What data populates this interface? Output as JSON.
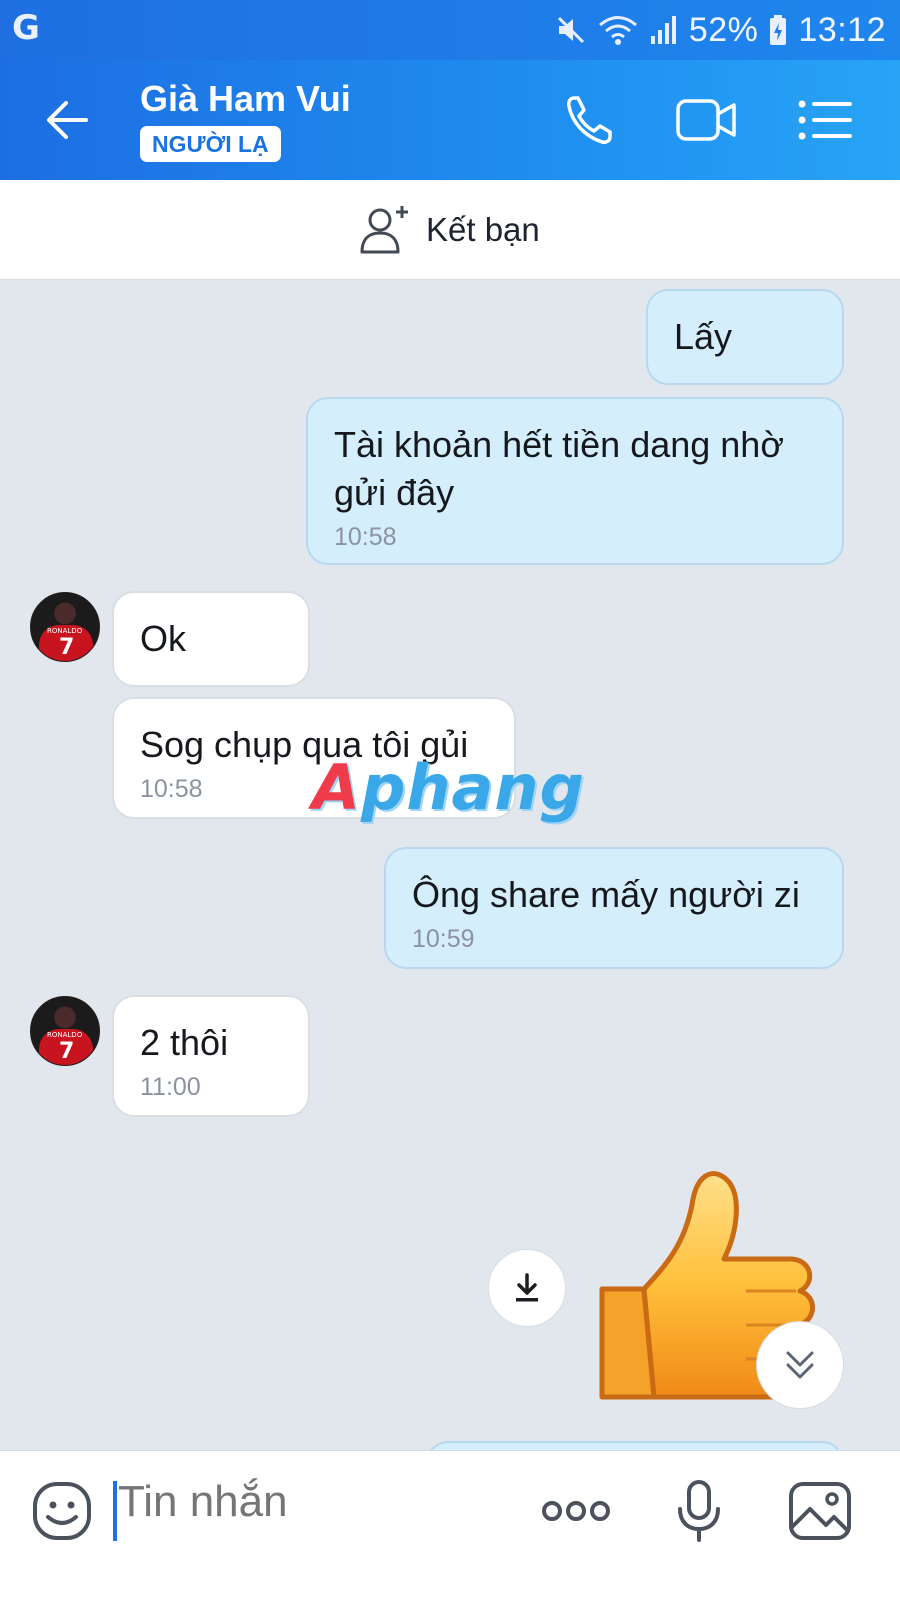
{
  "status_bar": {
    "left_icon": "G",
    "battery": "52%",
    "time": "13:12",
    "icons": [
      "mute-icon",
      "wifi-icon",
      "signal-icon",
      "battery-icon"
    ]
  },
  "header": {
    "contact_name": "Già Ham Vui",
    "badge": "NGƯỜI LẠ",
    "icons": [
      "back-arrow-icon",
      "phone-icon",
      "video-call-icon",
      "menu-list-icon"
    ]
  },
  "friend_bar": {
    "label": "Kết bạn"
  },
  "messages": [
    {
      "dir": "out",
      "text": "Lấy",
      "time": ""
    },
    {
      "dir": "out",
      "text_line1": "Tài khoản hết tiền dang nhờ",
      "text_line2": "gửi đây",
      "time": "10:58"
    },
    {
      "dir": "in",
      "text": "Ok",
      "time": ""
    },
    {
      "dir": "in",
      "text": "Sog chụp qua tôi gủi",
      "time": "10:58"
    },
    {
      "dir": "out",
      "text": "Ông share mấy người zi",
      "time": "10:59"
    },
    {
      "dir": "in",
      "text": "2 thôi",
      "time": "11:00"
    }
  ],
  "watermark": {
    "first": "A",
    "rest": "phang"
  },
  "avatar": {
    "shirt_name": "RONALDO",
    "shirt_number": "7"
  },
  "sticker": "thumbs-up-sticker",
  "input": {
    "placeholder": "Tin nhắn",
    "icons": [
      "emoji-icon",
      "more-icon",
      "microphone-icon",
      "image-icon"
    ]
  },
  "colors": {
    "header": "#1f86ee",
    "outgoing_bubble": "#d5eefc",
    "incoming_bubble": "#ffffff",
    "chat_bg": "#e2e7ee",
    "accent": "#1b72e0"
  }
}
